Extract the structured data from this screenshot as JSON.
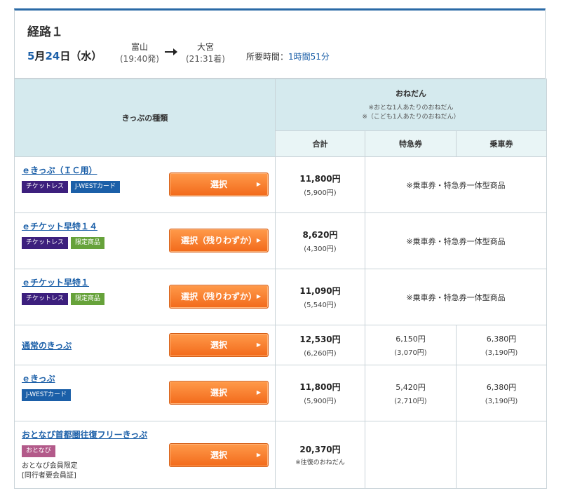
{
  "route": {
    "title": "経路１",
    "date_month": "5",
    "date_m_suffix": "月",
    "date_day": "24",
    "date_d_suffix": "日（水）",
    "from_station": "富山",
    "from_time": "(19:40発)",
    "to_station": "大宮",
    "to_time": "(21:31着)",
    "duration_label": "所要時間：",
    "duration_value": "1時間51分"
  },
  "table": {
    "col_type": "きっぷの種類",
    "col_price": "おねだん",
    "price_note_1": "※おとな1人あたりのおねだん",
    "price_note_2": "※（こども1人あたりのおねだん）",
    "sub_total": "合計",
    "sub_express": "特急券",
    "sub_fare": "乗車券"
  },
  "rows": [
    {
      "name": "ｅきっぷ（ＩＣ用）",
      "tags": [
        "チケットレス",
        "J-WESTカード"
      ],
      "button": "選択",
      "total": "11,800円",
      "total_child": "(5,900円)",
      "combined_note": "※乗車券・特急券一体型商品"
    },
    {
      "name": "ｅチケット早特１４",
      "tags": [
        "チケットレス",
        "限定商品"
      ],
      "button": "選択（残りわずか）",
      "total": "8,620円",
      "total_child": "(4,300円)",
      "combined_note": "※乗車券・特急券一体型商品"
    },
    {
      "name": "ｅチケット早特１",
      "tags": [
        "チケットレス",
        "限定商品"
      ],
      "button": "選択（残りわずか）",
      "total": "11,090円",
      "total_child": "(5,540円)",
      "combined_note": "※乗車券・特急券一体型商品"
    },
    {
      "name": "通常のきっぷ",
      "tags": [],
      "button": "選択",
      "total": "12,530円",
      "total_child": "(6,260円)",
      "express": "6,150円",
      "express_child": "(3,070円)",
      "fare": "6,380円",
      "fare_child": "(3,190円)"
    },
    {
      "name": "ｅきっぷ",
      "tags": [
        "J-WESTカード"
      ],
      "button": "選択",
      "total": "11,800円",
      "total_child": "(5,900円)",
      "express": "5,420円",
      "express_child": "(2,710円)",
      "fare": "6,380円",
      "fare_child": "(3,190円)"
    },
    {
      "name": "おとなび首都圏往復フリーきっぷ",
      "tags": [
        "おとなび"
      ],
      "member_note_1": "おとなび会員限定",
      "member_note_2": "[同行者要会員証]",
      "button": "選択",
      "total": "20,370円",
      "total_note": "※往復のおねだん"
    }
  ]
}
